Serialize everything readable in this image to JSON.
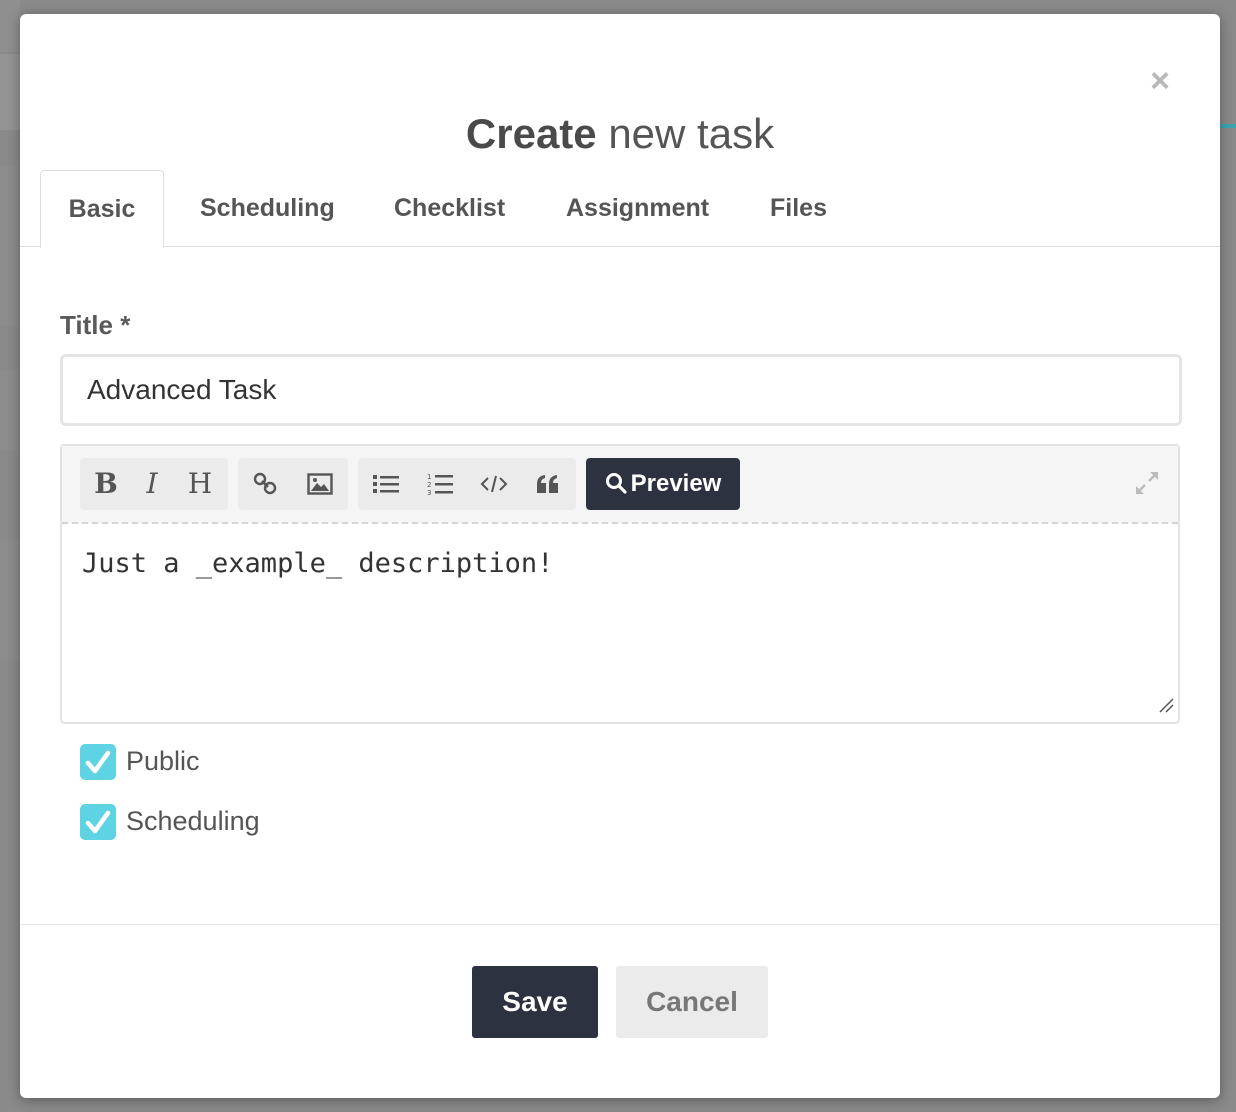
{
  "modal": {
    "close_symbol": "×",
    "title_bold": "Create",
    "title_light": "new task"
  },
  "tabs": [
    {
      "label": "Basic",
      "active": true
    },
    {
      "label": "Scheduling",
      "active": false
    },
    {
      "label": "Checklist",
      "active": false
    },
    {
      "label": "Assignment",
      "active": false
    },
    {
      "label": "Files",
      "active": false
    }
  ],
  "form": {
    "title_label": "Title *",
    "title_value": "Advanced Task"
  },
  "editor": {
    "toolbar": {
      "bold": "B",
      "italic": "I",
      "heading": "H",
      "preview_label": "Preview",
      "icons": [
        "bold-icon",
        "italic-icon",
        "heading-icon",
        "link-icon",
        "image-icon",
        "unordered-list-icon",
        "ordered-list-icon",
        "code-icon",
        "quote-icon",
        "search-icon",
        "fullscreen-icon"
      ]
    },
    "content": "Just a _example_ description!"
  },
  "checkboxes": [
    {
      "label": "Public",
      "checked": true
    },
    {
      "label": "Scheduling",
      "checked": true
    }
  ],
  "footer": {
    "save_label": "Save",
    "cancel_label": "Cancel"
  },
  "colors": {
    "primary_dark": "#2d3240",
    "checkbox_accent": "#5ed3e3",
    "overlay": "#7f7f7f"
  }
}
